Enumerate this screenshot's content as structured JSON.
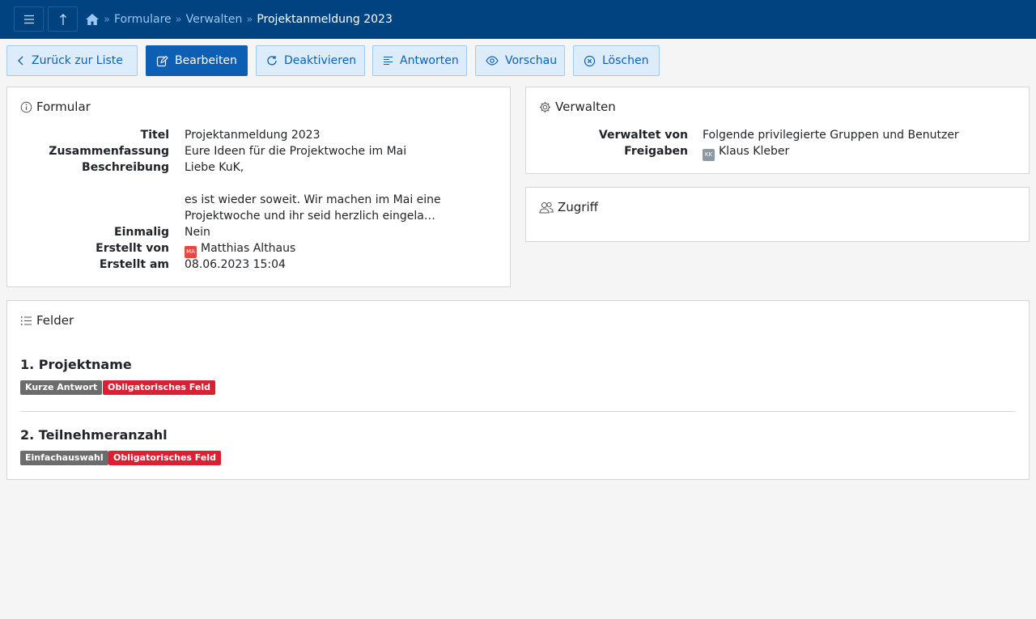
{
  "breadcrumb": {
    "items": [
      "Formulare",
      "Verwalten"
    ],
    "separator": "»",
    "current": "Projektanmeldung 2023"
  },
  "icons": {
    "menu": "menu-icon",
    "up": "arrow-up-icon",
    "home": "home-icon"
  },
  "actions": {
    "back": "Zurück zur Liste",
    "edit": "Bearbeiten",
    "deactivate": "Deaktivieren",
    "answers": "Antworten",
    "preview": "Vorschau",
    "delete": "Löschen"
  },
  "form_card": {
    "heading": "Formular",
    "rows": {
      "title": {
        "label": "Titel",
        "value": "Projektanmeldung 2023"
      },
      "summary": {
        "label": "Zusammenfassung",
        "value": "Eure Ideen für die Projektwoche im Mai"
      },
      "description": {
        "label": "Beschreibung",
        "line1": "Liebe KuK,",
        "line2": "es ist wieder soweit. Wir machen im Mai eine",
        "line3": "Projektwoche und ihr seid herzlich eingela…"
      },
      "once": {
        "label": "Einmalig",
        "value": "Nein"
      },
      "created_by": {
        "label": "Erstellt von",
        "avatar": "MA",
        "value": "Matthias Althaus"
      },
      "created_at": {
        "label": "Erstellt am",
        "value": "08.06.2023 15:04"
      }
    }
  },
  "manage_card": {
    "heading": "Verwalten",
    "rows": {
      "managed_by": {
        "label": "Verwaltet von",
        "value": "Folgende privilegierte Gruppen und Benutzer"
      },
      "shares": {
        "label": "Freigaben",
        "avatar": "KK",
        "value": "Klaus Kleber"
      }
    }
  },
  "access_card": {
    "heading": "Zugriff"
  },
  "fields_card": {
    "heading": "Felder",
    "fields": [
      {
        "title": "1. Projektname",
        "type": "Kurze Antwort",
        "required": "Obligatorisches Feld"
      },
      {
        "title": "2. Teilnehmeranzahl",
        "type": "Einfachauswahl",
        "required": "Obligatorisches Feld"
      }
    ]
  },
  "colors": {
    "topbar": "#004381",
    "primary": "#0d5fb3",
    "required_badge": "#dc2033",
    "type_badge": "#6c6c6c"
  }
}
